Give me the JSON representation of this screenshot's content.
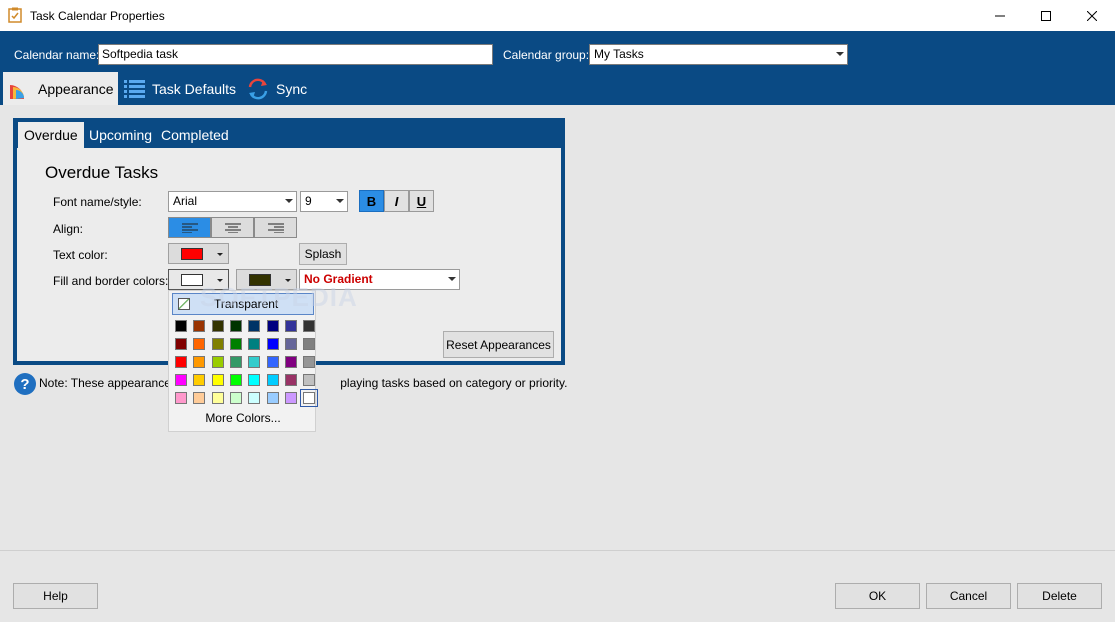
{
  "window": {
    "title": "Task Calendar Properties"
  },
  "header": {
    "calendar_name_label": "Calendar name:",
    "calendar_name_value": "Softpedia task",
    "calendar_group_label": "Calendar group:",
    "calendar_group_value": "My Tasks"
  },
  "main_tabs": [
    {
      "label": "Appearance",
      "icon": "appearance-icon",
      "active": true
    },
    {
      "label": "Task Defaults",
      "icon": "list-icon"
    },
    {
      "label": "Sync",
      "icon": "sync-icon"
    }
  ],
  "sub_tabs": [
    {
      "label": "Overdue",
      "active": true
    },
    {
      "label": "Upcoming"
    },
    {
      "label": "Completed"
    }
  ],
  "section": {
    "title": "Overdue Tasks"
  },
  "form": {
    "font_label": "Font name/style:",
    "font_name": "Arial",
    "font_size": "9",
    "bold": "B",
    "italic": "I",
    "underline": "U",
    "align_label": "Align:",
    "text_color_label": "Text color:",
    "text_color": "#ff0000",
    "splash_label": "Splash",
    "fill_label": "Fill and border colors:",
    "fill_color": "#ffffff",
    "border_color": "#333300",
    "gradient_value": "No Gradient",
    "reset_label": "Reset Appearances"
  },
  "note": {
    "text": "Note: These appearance s                                                playing tasks based on category or priority."
  },
  "color_popup": {
    "transparent_label": "Transparent",
    "more_colors_label": "More Colors...",
    "rows": [
      [
        "#000000",
        "#993300",
        "#333300",
        "#003300",
        "#003366",
        "#000080",
        "#333399",
        "#333333"
      ],
      [
        "#800000",
        "#ff6600",
        "#808000",
        "#008000",
        "#008080",
        "#0000ff",
        "#666699",
        "#808080"
      ],
      [
        "#ff0000",
        "#ff9900",
        "#99cc00",
        "#339966",
        "#33cccc",
        "#3366ff",
        "#800080",
        "#969696"
      ],
      [
        "#ff00ff",
        "#ffcc00",
        "#ffff00",
        "#00ff00",
        "#00ffff",
        "#00ccff",
        "#993366",
        "#c0c0c0"
      ],
      [
        "#ff99cc",
        "#ffcc99",
        "#ffff99",
        "#ccffcc",
        "#ccffff",
        "#99ccff",
        "#cc99ff",
        "#ffffff"
      ]
    ]
  },
  "watermark": "SOFTPEDIA",
  "footer": {
    "help": "Help",
    "ok": "OK",
    "cancel": "Cancel",
    "delete": "Delete"
  }
}
